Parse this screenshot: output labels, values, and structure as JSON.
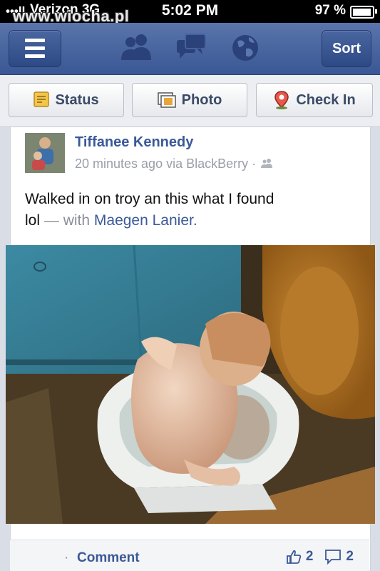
{
  "status_bar": {
    "signal": "•••ll",
    "carrier": "Verizon 3G",
    "watermark": "www.wiocha.pl",
    "time": "5:02 PM",
    "battery_percent": "97 %"
  },
  "navbar": {
    "menu_icon": "hamburger-icon",
    "icons": [
      "friends-icon",
      "messages-icon",
      "globe-icon"
    ],
    "sort_label": "Sort"
  },
  "action_bar": {
    "status_label": "Status",
    "photo_label": "Photo",
    "checkin_label": "Check In"
  },
  "post": {
    "author": "Tiffanee Kennedy",
    "meta": "20 minutes ago via BlackBerry ·",
    "text_line1": "Walked in on troy an this what I found",
    "text_line2_start": "lol",
    "with_text": "— with",
    "tagged": "Maegen Lanier.",
    "comment_label": "Comment",
    "likes": "2",
    "comments": "2"
  },
  "colors": {
    "nav_blue": "#3a5795",
    "link_blue": "#3b5998"
  }
}
